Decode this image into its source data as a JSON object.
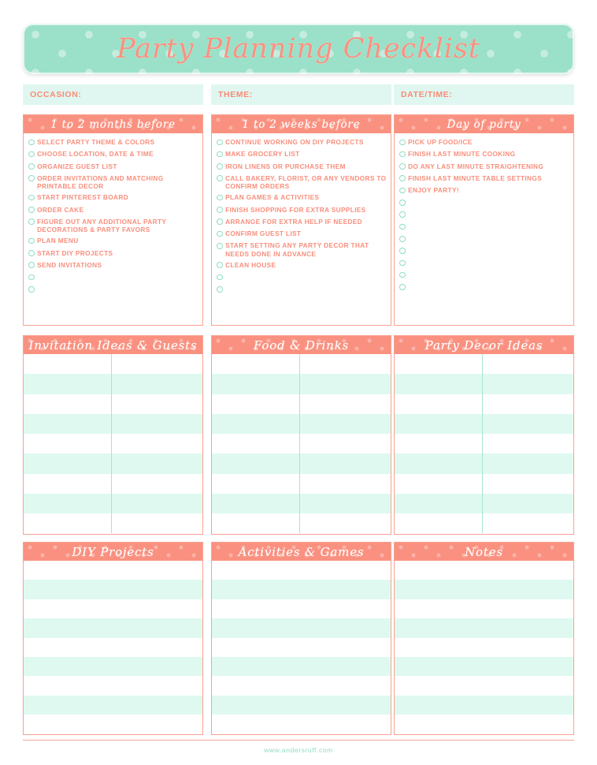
{
  "banner": {
    "title": "Party Planning Checklist"
  },
  "fields": [
    {
      "label": "OCCASION:"
    },
    {
      "label": "THEME:"
    },
    {
      "label": "DATE/TIME:"
    }
  ],
  "checklists": [
    {
      "title": "1 to 2 months before",
      "items": [
        "SELECT PARTY THEME & COLORS",
        "CHOOSE LOCATION, DATE & TIME",
        "ORGANIZE GUEST LIST",
        "ORDER INVITATIONS AND MATCHING PRINTABLE DECOR",
        "START PINTEREST BOARD",
        "ORDER CAKE",
        "FIGURE OUT ANY ADDITIONAL PARTY DECORATIONS & PARTY FAVORS",
        "PLAN MENU",
        "START DIY PROJECTS",
        "SEND INVITATIONS"
      ],
      "blank_rows": 2
    },
    {
      "title": "1 to 2 weeks before",
      "items": [
        "CONTINUE WORKING ON DIY PROJECTS",
        "MAKE GROCERY LIST",
        "IRON LINENS OR PURCHASE THEM",
        "CALL BAKERY, FLORIST, OR ANY VENDORS TO CONFIRM ORDERS",
        "PLAN GAMES & ACTIVITIES",
        "FINISH SHOPPING FOR EXTRA SUPPLIES",
        "ARRANGE FOR EXTRA HELP IF NEEDED",
        "CONFIRM GUEST LIST",
        "START SETTING ANY PARTY DECOR THAT NEEDS DONE IN ADVANCE",
        "CLEAN HOUSE"
      ],
      "blank_rows": 2
    },
    {
      "title": "Day of party",
      "items": [
        "PICK UP FOOD/ICE",
        "FINISH LAST MINUTE COOKING",
        "DO ANY LAST MINUTE STRAIGHTENING",
        "FINISH LAST MINUTE TABLE SETTINGS",
        "ENJOY PARTY!"
      ],
      "blank_rows": 8
    }
  ],
  "middle_panels": [
    {
      "title": "Invitation Ideas & Guests",
      "rows": 9,
      "has_divider": true
    },
    {
      "title": "Food & Drinks",
      "rows": 9,
      "has_divider": true
    },
    {
      "title": "Party Decor Ideas",
      "rows": 9,
      "has_divider": true
    }
  ],
  "bottom_panels": [
    {
      "title": "DIY Projects",
      "rows": 9,
      "has_divider": false
    },
    {
      "title": "Activities & Games",
      "rows": 9,
      "has_divider": false
    },
    {
      "title": "Notes",
      "rows": 9,
      "has_divider": false
    }
  ],
  "footer": {
    "url": "www.andersruff.com"
  },
  "colors": {
    "coral": "#FA9180",
    "coral_text": "#F98E7C",
    "mint": "#9BE0C8",
    "mint_pale": "#DFF7F0",
    "stripe_mint": "#DFF9F1",
    "border_coral": "#F7A292",
    "divider_mint": "#A9E3D4"
  }
}
